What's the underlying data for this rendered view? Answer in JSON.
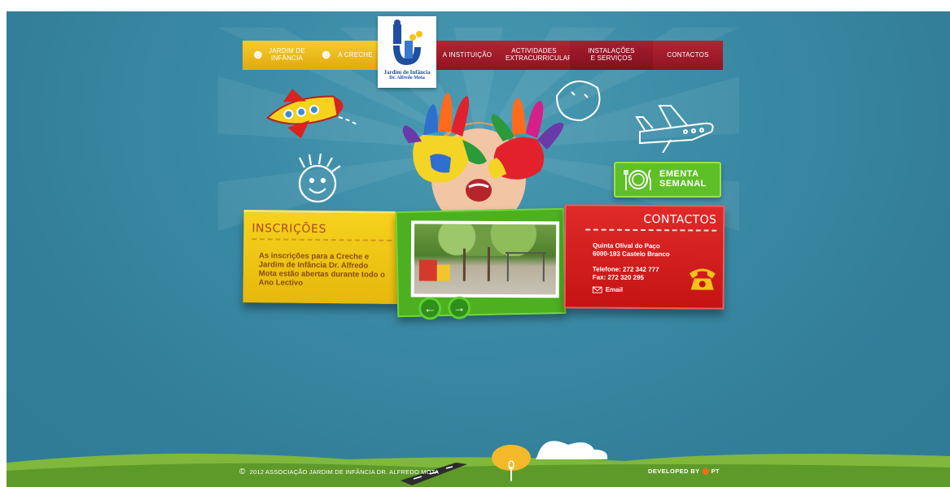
{
  "nav": {
    "jardim": "JARDIM DE INFÂNCIA",
    "creche": "A CRECHE",
    "instituicao": "A INSTITUIÇÃO",
    "actividades": "ACTIVIDADES EXTRACURRICULARES",
    "instalacoes": "INSTALAÇÕES E SERVIÇOS",
    "contactos": "CONTACTOS"
  },
  "logo": {
    "line1": "Jardim de Infância",
    "line2": "Dr. Alfredo Mota"
  },
  "ementa": {
    "line1": "EMENTA",
    "line2": "SEMANAL"
  },
  "inscricoes": {
    "title": "INSCRIÇÕES",
    "text": "As inscrições para a Creche e Jardim de Infância Dr. Alfredo Mota estão abertas durante todo o Ano Lectivo"
  },
  "gallery": {
    "prev_icon": "arrow-left",
    "next_icon": "arrow-right"
  },
  "contactos": {
    "title": "CONTACTOS",
    "address1": "Quinta Olival do Paço",
    "address2": "6000-193 Castelo Branco",
    "telefone": "Telefone: 272 342 777",
    "fax": "Fax: 272 320 295",
    "email": "Email"
  },
  "footer": {
    "copyright": "2012 ASSOCIAÇÃO JARDIM DE INFÂNCIA DR. ALFREDO MOTA",
    "developed_by": "DEVELOPED BY",
    "developer": "PT"
  },
  "colors": {
    "background": "#3b8ba6",
    "nav_yellow": "#e9b617",
    "nav_red": "#9e1a29",
    "panel_yellow": "#f0c818",
    "panel_green": "#4cb021",
    "panel_red": "#d81f1f",
    "ementa_green": "#5fbf28"
  }
}
